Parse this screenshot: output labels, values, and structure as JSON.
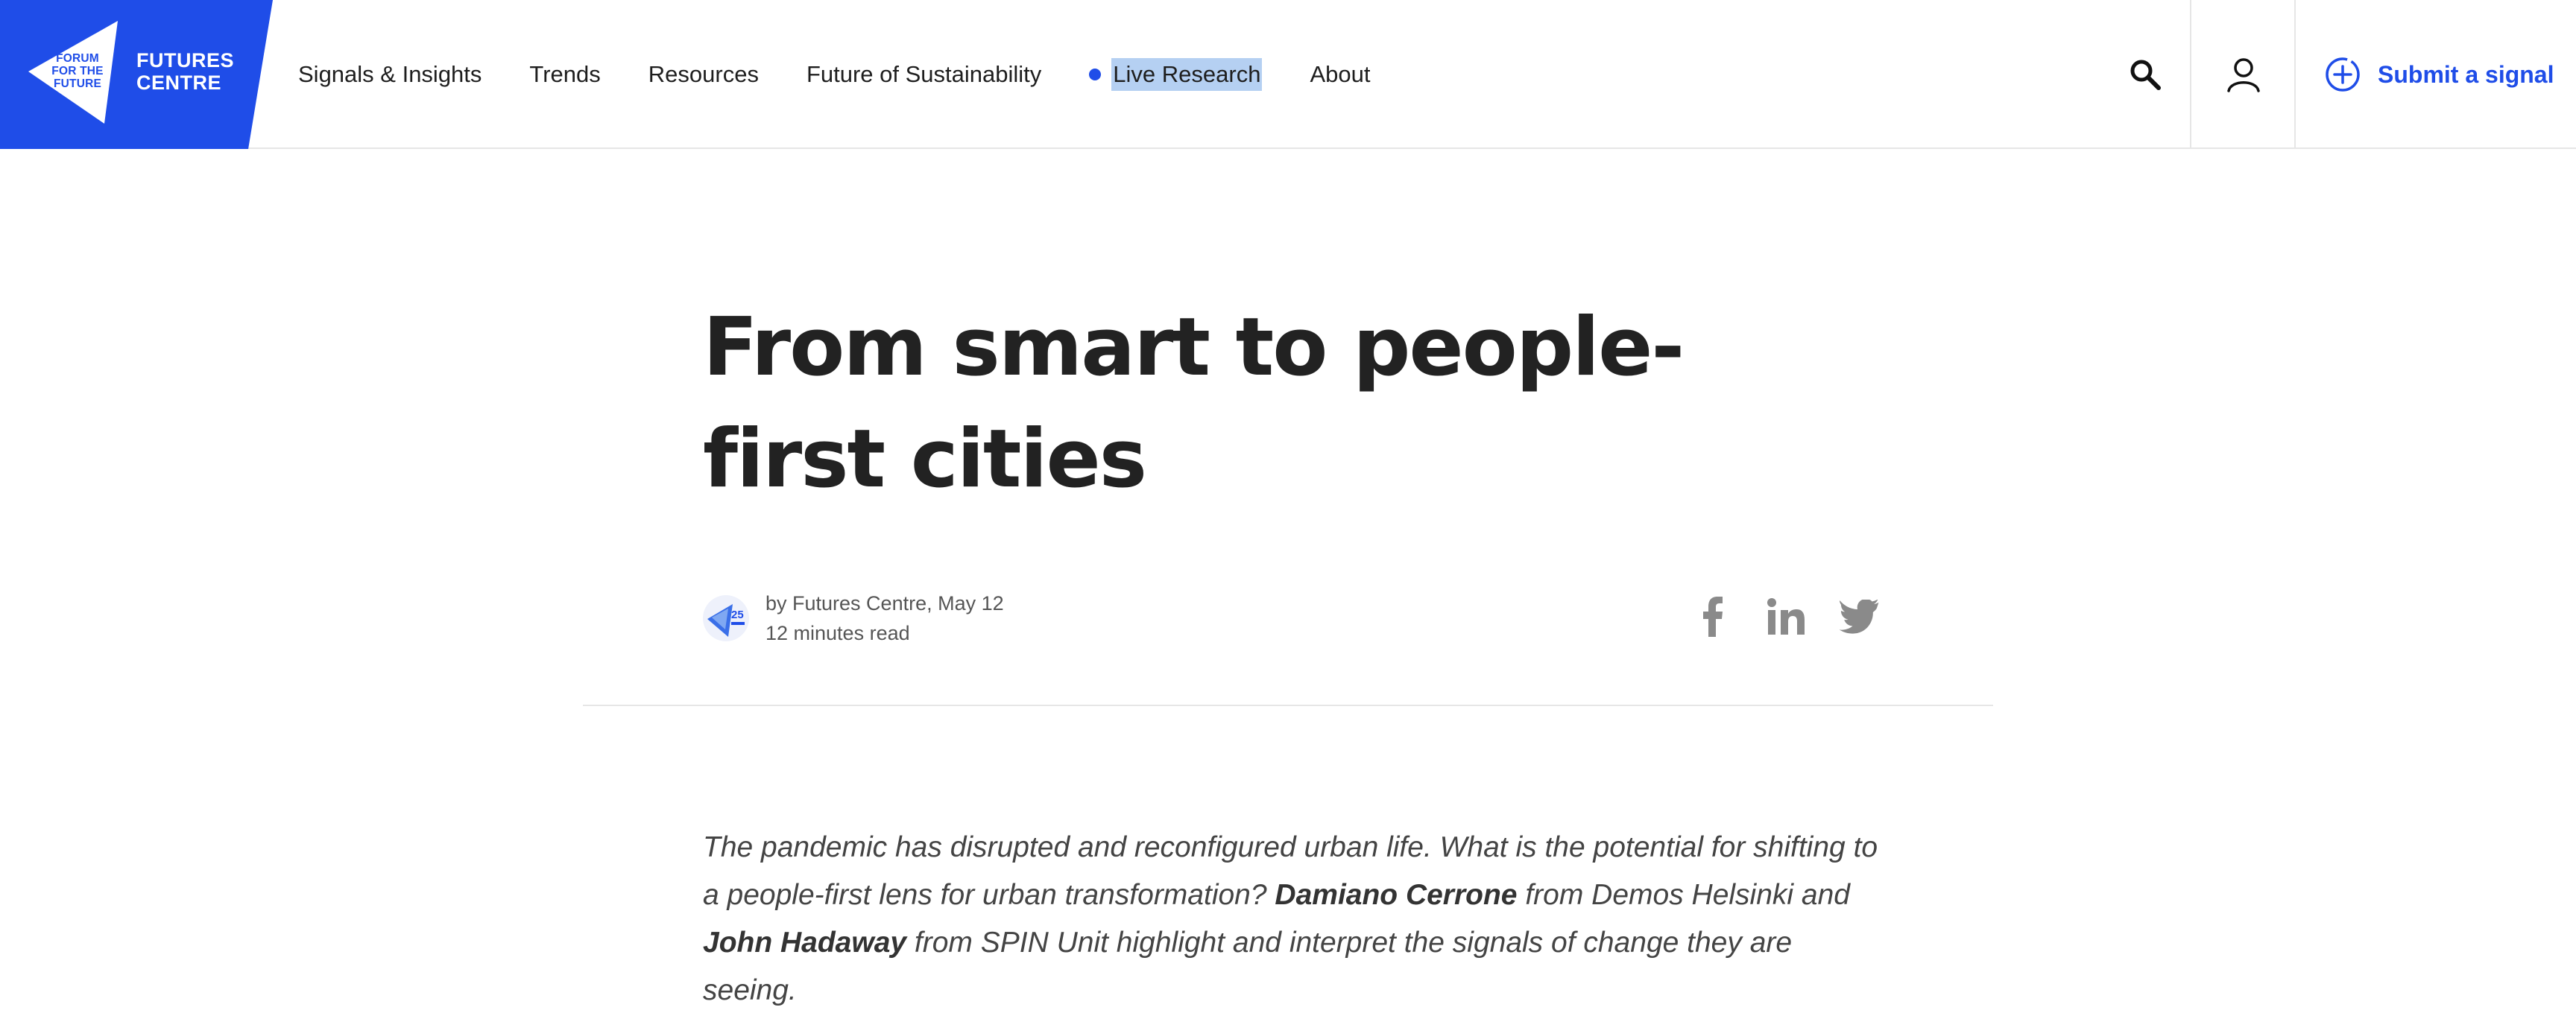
{
  "brand": {
    "small": [
      "FORUM",
      "FOR THE",
      "FUTURE"
    ],
    "big": [
      "FUTURES",
      "CENTRE"
    ],
    "color": "#1f4de8"
  },
  "nav": {
    "items": [
      {
        "label": "Signals & Insights"
      },
      {
        "label": "Trends"
      },
      {
        "label": "Resources"
      },
      {
        "label": "Future of Sustainability"
      },
      {
        "label": "Live Research",
        "live": true
      },
      {
        "label": "About"
      }
    ]
  },
  "header": {
    "search_icon": "search-icon",
    "account_icon": "user-icon",
    "submit_label": "Submit a signal"
  },
  "article": {
    "title": "From smart to people-first cities",
    "byline": "by Futures Centre, May 12",
    "read_time": "12 minutes read",
    "avatar_badge": "25",
    "share": [
      "facebook-icon",
      "linkedin-icon",
      "twitter-icon"
    ],
    "lede": {
      "part1": "The pandemic has disrupted and reconfigured urban life. What is the potential for shifting to a people-first lens for urban transformation? ",
      "name1": "Damiano Cerrone",
      "part2": " from Demos Helsinki and ",
      "name2": "John Hadaway",
      "part3": " from SPIN Unit highlight and interpret the signals of change they are seeing."
    }
  }
}
